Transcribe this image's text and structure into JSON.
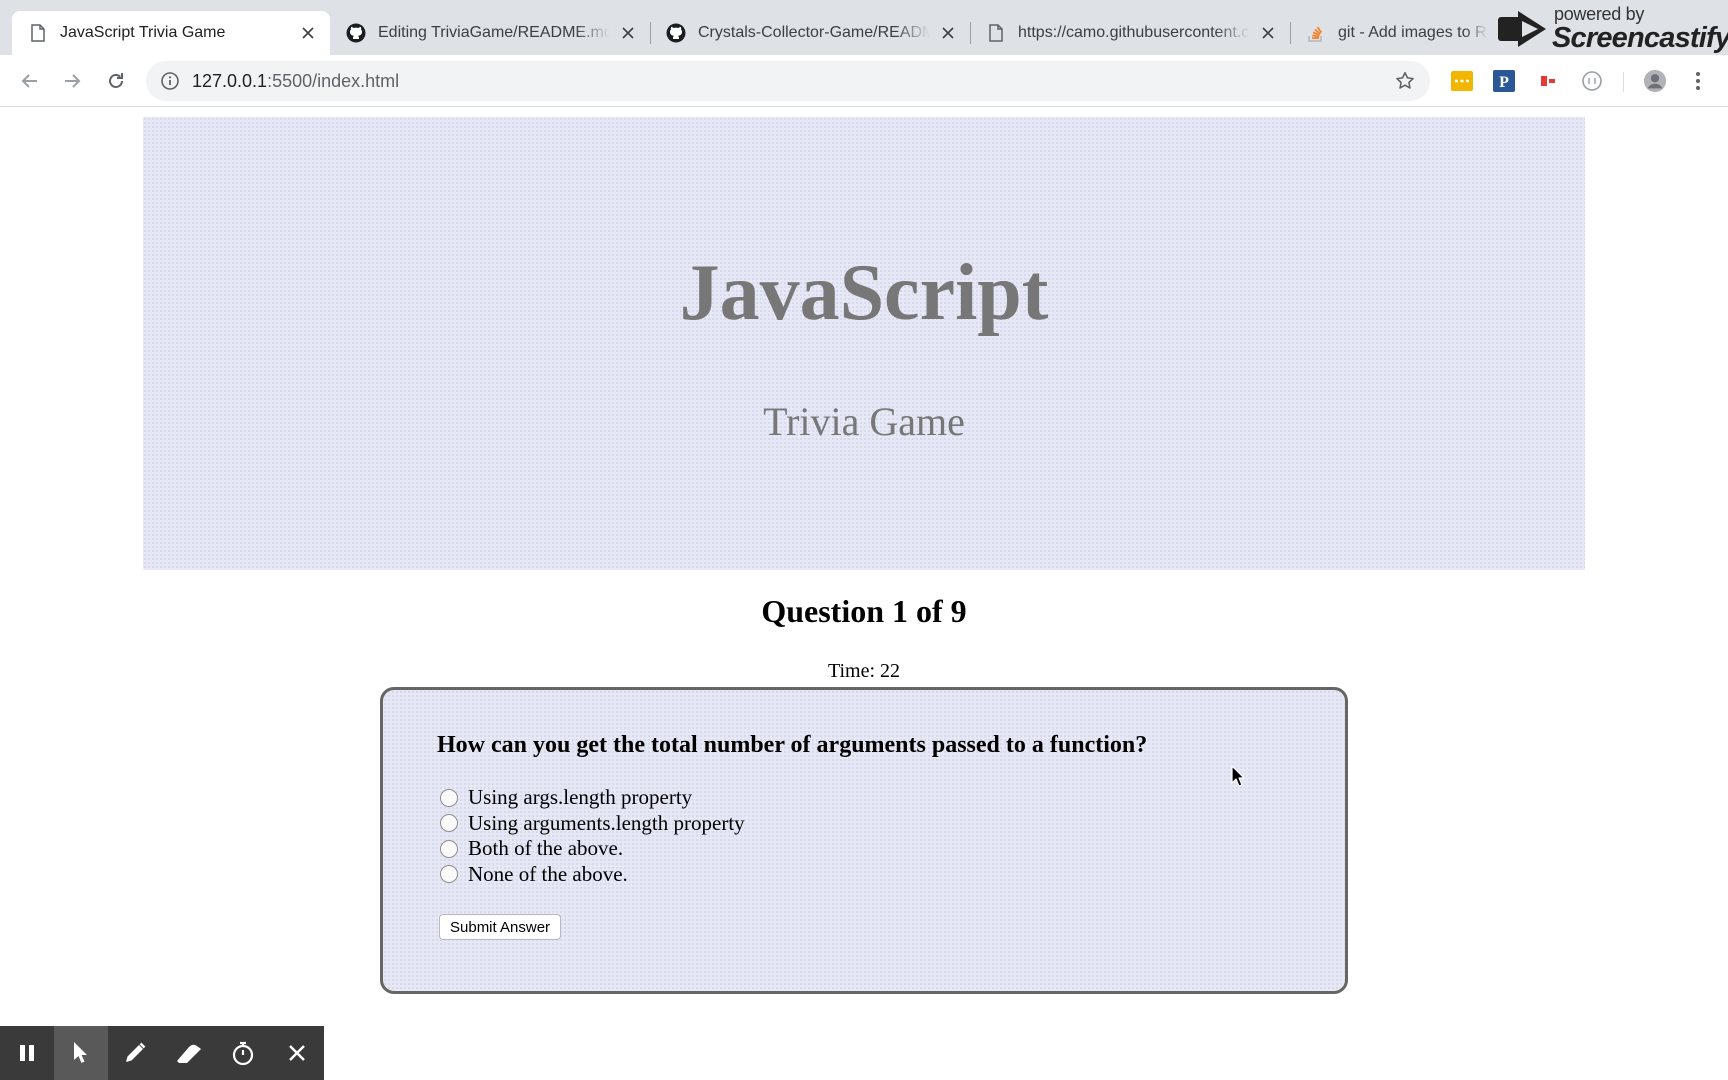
{
  "browser": {
    "tabs": [
      {
        "title": "JavaScript Trivia Game",
        "icon": "page-icon",
        "active": true
      },
      {
        "title": "Editing TriviaGame/README.md",
        "icon": "github-icon",
        "active": false
      },
      {
        "title": "Crystals-Collector-Game/README.md",
        "icon": "github-icon",
        "active": false
      },
      {
        "title": "https://camo.githubusercontent.com",
        "icon": "page-icon",
        "active": false
      },
      {
        "title": "git - Add images to README.md",
        "icon": "stackoverflow-icon",
        "active": false
      }
    ],
    "address": {
      "host": "127.0.0.1",
      "rest": ":5500/index.html"
    }
  },
  "screencastify": {
    "powered_by": "powered by",
    "brand": "Screencastify"
  },
  "page": {
    "header": {
      "title": "JavaScript",
      "subtitle": "Trivia Game"
    },
    "question_heading": "Question 1 of 9",
    "timer": {
      "label": "Time:",
      "value": "22"
    },
    "question": "How can you get the total number of arguments passed to a function?",
    "answers": [
      "Using args.length property",
      "Using arguments.length property",
      "Both of the above.",
      "None of the above."
    ],
    "submit_label": "Submit Answer"
  },
  "recorder": {
    "buttons": [
      "pause-icon",
      "cursor-icon",
      "pen-icon",
      "eraser-icon",
      "timer-icon",
      "close-icon"
    ],
    "selected": "cursor-icon"
  },
  "colors": {
    "jumbotron_bg": "#e6e8f5",
    "heading_gray": "#777777",
    "tabbar": "#dee1e6",
    "recorder_bg": "#3a3a3a"
  }
}
